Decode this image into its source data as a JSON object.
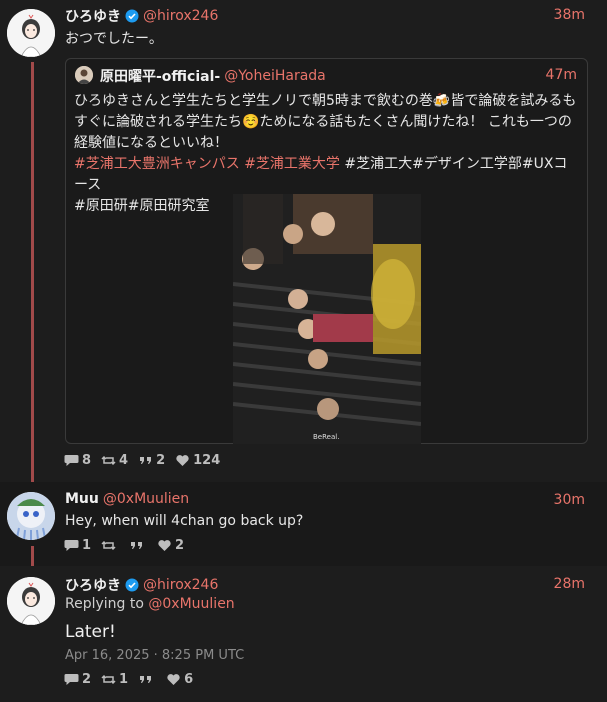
{
  "tweets": [
    {
      "name": "ひろゆき",
      "handle": "@hirox246",
      "time": "38m",
      "verified": true,
      "text": "おつでしたー。",
      "quote": {
        "name": "原田曜平-official-",
        "handle": "@YoheiHarada",
        "time": "47m",
        "text_line1": "ひろゆきさんと学生たちと学生ノリで朝5時まで飲むの巻🍻皆で論破を試みるも",
        "text_line2": "すぐに論破される学生たち☺️ためになる話もたくさん聞けたね！ これも一つの",
        "text_line3": "経験値になるといいね！",
        "hashtag1": "#芝浦工大豊洲キャンパス",
        "hashtag2": "#芝浦工業大学",
        "plain_tags_line4": "#芝浦工大#デザイン工学部#UXコース",
        "plain_tags_line5": "#原田研#原田研究室",
        "image_watermark": "BeReal."
      },
      "stats": {
        "replies": "8",
        "retweets": "4",
        "quotes": "2",
        "likes": "124"
      }
    },
    {
      "name": "Muu",
      "handle": "@0xMuulien",
      "time": "30m",
      "text": "Hey, when will 4chan go back up?",
      "stats": {
        "replies": "1",
        "retweets": "",
        "quotes": "",
        "likes": "2"
      }
    },
    {
      "name": "ひろゆき",
      "handle": "@hirox246",
      "time": "28m",
      "verified": true,
      "replying_prefix": "Replying to",
      "replying_to": "@0xMuulien",
      "text": "Later!",
      "date": "Apr 16, 2025 · 8:25 PM UTC",
      "stats": {
        "replies": "2",
        "retweets": "1",
        "quotes": "",
        "likes": "6"
      }
    }
  ],
  "icons": [
    "comment-icon",
    "retweet-icon",
    "quote-icon",
    "heart-icon",
    "verified-icon"
  ],
  "colors": {
    "accent": "#e8746a",
    "thread": "#a14a4a",
    "verified": "#1d9bf0",
    "background": "#181818"
  }
}
